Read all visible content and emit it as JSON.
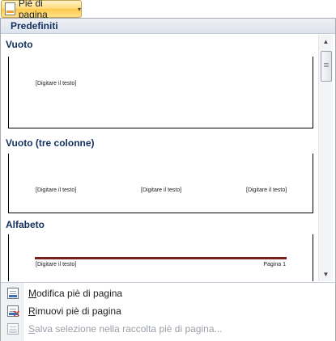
{
  "ribbon_button": {
    "label": "Piè di pagina",
    "icon": "footer-icon",
    "caret": "▾"
  },
  "gallery": {
    "section_title": "Predefiniti",
    "items": [
      {
        "label": "Vuoto",
        "placeholders": [
          "[Digitare il testo]"
        ]
      },
      {
        "label": "Vuoto (tre colonne)",
        "placeholders": [
          "[Digitare il testo]",
          "[Digitare il testo]",
          "[Digitare il testo]"
        ]
      },
      {
        "label": "Alfabeto",
        "placeholders": [
          "[Digitare il testo]"
        ],
        "page_text": "Pagina 1"
      }
    ]
  },
  "commands": [
    {
      "label_prefix": "",
      "accel": "M",
      "label_rest": "odifica piè di pagina",
      "icon": "edit-footer-icon",
      "enabled": true
    },
    {
      "label_prefix": "",
      "accel": "R",
      "label_rest": "imuovi piè di pagina",
      "icon": "remove-footer-icon",
      "enabled": true
    },
    {
      "label_prefix": "",
      "accel": "S",
      "label_rest": "alva selezione nella raccolta piè di pagina...",
      "icon": "save-selection-icon",
      "enabled": false
    }
  ],
  "colors": {
    "accent": "#14305e",
    "rule": "#7a1f1a",
    "button": "#ffd978"
  }
}
